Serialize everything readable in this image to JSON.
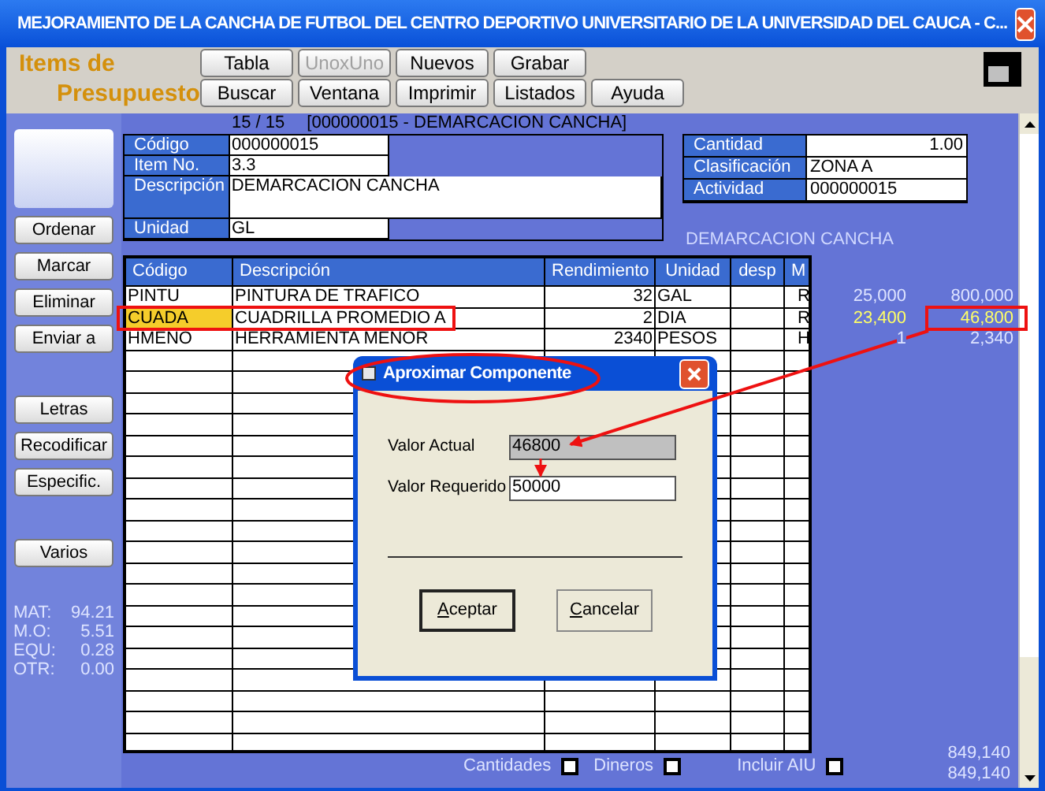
{
  "window": {
    "title": "MEJORAMIENTO DE LA CANCHA DE FUTBOL DEL CENTRO DEPORTIVO UNIVERSITARIO DE LA UNIVERSIDAD DEL CAUCA - C..."
  },
  "toolbar": {
    "heading_lines": [
      "Items de",
      "Presupuesto"
    ],
    "button_rows": [
      [
        {
          "label": "Tabla",
          "disabled": false
        },
        {
          "label": "UnoxUno",
          "disabled": true
        },
        {
          "label": "Nuevos",
          "disabled": false
        },
        {
          "label": "Grabar",
          "disabled": false
        }
      ],
      [
        {
          "label": "Buscar",
          "disabled": false
        },
        {
          "label": "Ventana",
          "disabled": false
        },
        {
          "label": "Imprimir",
          "disabled": false
        },
        {
          "label": "Listados",
          "disabled": false
        },
        {
          "label": "Ayuda",
          "disabled": false
        }
      ]
    ]
  },
  "sidebar": {
    "button_groups": [
      [
        "Ordenar",
        "Marcar",
        "Eliminar",
        "Enviar a"
      ],
      [
        "Letras",
        "Recodificar",
        "Especific."
      ],
      [
        "Varios"
      ]
    ],
    "summary": [
      {
        "label": "MAT:",
        "value": "94.21"
      },
      {
        "label": "M.O:",
        "value": "5.51"
      },
      {
        "label": "EQU:",
        "value": "0.28"
      },
      {
        "label": "OTR:",
        "value": "0.00"
      }
    ]
  },
  "record": {
    "position": "15 / 15",
    "name": "[000000015 - DEMARCACION CANCHA]"
  },
  "item_fields": [
    {
      "label": "Código",
      "value": "000000015",
      "kind": "short"
    },
    {
      "label": "Item No.",
      "value": "3.3",
      "kind": "short"
    },
    {
      "label": "Descripción",
      "value": "DEMARCACION CANCHA",
      "kind": "long"
    },
    {
      "label": "Unidad",
      "value": "GL",
      "kind": "short"
    }
  ],
  "quantity_fields": [
    {
      "label": "Cantidad",
      "value": "1.00",
      "kind": "number"
    },
    {
      "label": "Clasificación",
      "value": "ZONA A",
      "kind": "text"
    },
    {
      "label": "Actividad",
      "value": "000000015",
      "kind": "text"
    }
  ],
  "grid_caption": "DEMARCACION CANCHA",
  "table": {
    "columns": [
      "Código",
      "Descripción",
      "Rendimiento",
      "Unidad",
      "desp",
      "M"
    ],
    "rows": [
      {
        "code": "PINTU",
        "description": "PINTURA DE TRAFICO",
        "yield": "32",
        "unit": "GAL",
        "m": "R",
        "price": "25,000",
        "total": "800,000",
        "selected": false
      },
      {
        "code": "CUADA",
        "description": "CUADRILLA PROMEDIO A",
        "yield": "2",
        "unit": "DIA",
        "m": "R",
        "price": "23,400",
        "total": "46,800",
        "selected": true
      },
      {
        "code": "HMENO",
        "description": "HERRAMIENTA MENOR",
        "yield": "2340",
        "unit": "PESOS",
        "m": "H",
        "price": "1",
        "total": "2,340",
        "selected": false
      }
    ]
  },
  "footer": {
    "checkboxes": [
      {
        "label": "Cantidades",
        "checked": false
      },
      {
        "label": "Dineros",
        "checked": false
      },
      {
        "label": "Incluir AIU",
        "checked": false
      }
    ],
    "totals": [
      "849,140",
      "849,140"
    ]
  },
  "dialog": {
    "title": "Aproximar Componente",
    "fields": [
      {
        "label": "Valor Actual",
        "value": "46800",
        "disabled": true
      },
      {
        "label": "Valor Requerido",
        "value": "50000",
        "disabled": false
      }
    ],
    "buttons": [
      {
        "label": "Aceptar",
        "default": true
      },
      {
        "label": "Cancelar",
        "default": false
      }
    ]
  }
}
